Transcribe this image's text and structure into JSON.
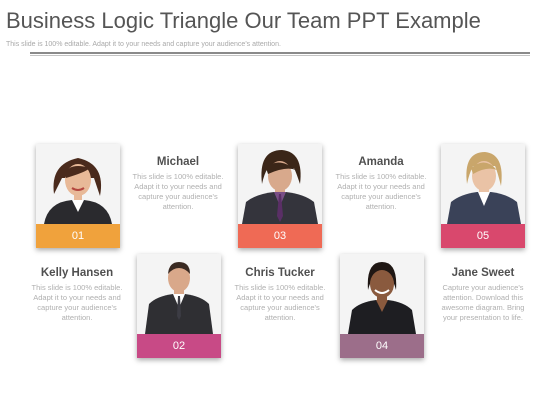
{
  "slide": {
    "title": "Business Logic Triangle Our Team PPT Example",
    "subtitle": "This slide is 100% editable. Adapt it to your needs and capture your audience's attention."
  },
  "cards": [
    {
      "number": "01",
      "color": "#f0a23c",
      "portrait": "woman-dark-hair-portrait"
    },
    {
      "number": "02",
      "color": "#c84a86",
      "portrait": "man-suit-portrait"
    },
    {
      "number": "03",
      "color": "#ef6a55",
      "portrait": "man-long-hair-portrait"
    },
    {
      "number": "04",
      "color": "#9c6e8a",
      "portrait": "woman-smiling-portrait"
    },
    {
      "number": "05",
      "color": "#d9486d",
      "portrait": "woman-blonde-portrait"
    }
  ],
  "members": [
    {
      "name": "Michael",
      "description": "This slide is 100% editable. Adapt it to your needs and capture your audience's attention."
    },
    {
      "name": "Amanda",
      "description": "This slide is 100% editable. Adapt it to your needs and capture your audience's attention."
    },
    {
      "name": "Kelly Hansen",
      "description": "This slide is 100% editable. Adapt it to your needs and capture your audience's attention."
    },
    {
      "name": "Chris Tucker",
      "description": "This slide is 100% editable. Adapt it to your needs and capture your audience's attention."
    },
    {
      "name": "Jane Sweet",
      "description": "Capture your audience's attention. Download this awesome diagram. Bring your presentation to life."
    }
  ]
}
